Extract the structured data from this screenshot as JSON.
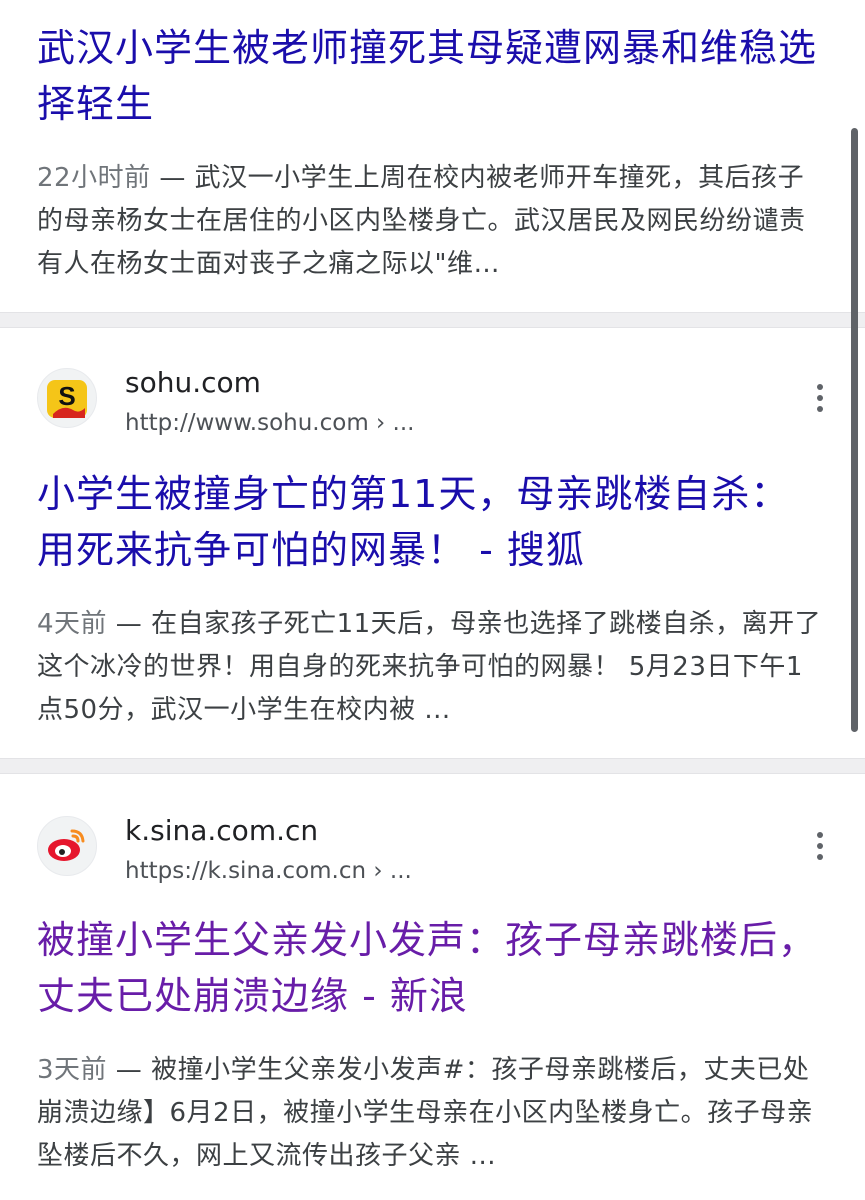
{
  "results": [
    {
      "title": "武汉小学生被老师撞死其母疑遭网暴和维稳选择轻生",
      "date": "22小时前",
      "snippet": " — 武汉一小学生上周在校内被老师开车撞死，其后孩子的母亲杨女士在居住的小区内坠楼身亡。武汉居民及网民纷纷谴责有人在杨女士面对丧子之痛之际以\"维…"
    },
    {
      "site_name": "sohu.com",
      "site_url": "http://www.sohu.com › ...",
      "favicon": "sohu-icon",
      "title": "小学生被撞身亡的第11天，母亲跳楼自杀：用死来抗争可怕的网暴！ - 搜狐",
      "date": "4天前",
      "snippet": " — 在自家孩子死亡11天后，母亲也选择了跳楼自杀，离开了这个冰冷的世界！用自身的死来抗争可怕的网暴！ 5月23日下午1点50分，武汉一小学生在校内被 ..."
    },
    {
      "site_name": "k.sina.com.cn",
      "site_url": "https://k.sina.com.cn › ...",
      "favicon": "weibo-icon",
      "title": "被撞小学生父亲发小发声：孩子母亲跳楼后，丈夫已处崩溃边缘 - 新浪",
      "date": "3天前",
      "snippet": " — 被撞小学生父亲发小发声#：孩子母亲跳楼后，丈夫已处崩溃边缘】6月2日，被撞小学生母亲在小区内坠楼身亡。孩子母亲坠楼后不久，网上又流传出孩子父亲 ..."
    }
  ],
  "colors": {
    "link": "#1a0dab",
    "visited_link": "#681da8",
    "snippet": "#3c4043",
    "meta": "#70757a",
    "separator": "#efeff1"
  }
}
